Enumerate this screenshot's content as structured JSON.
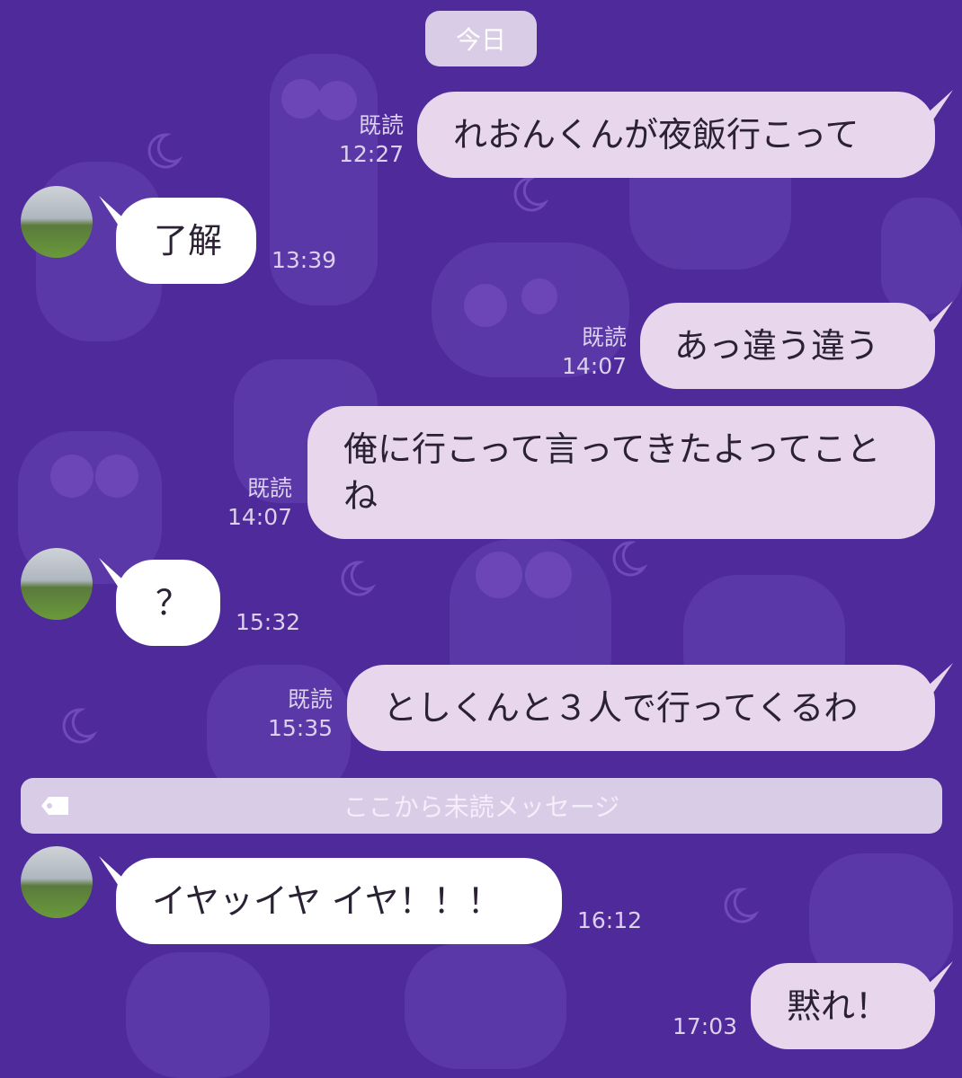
{
  "date_separator": "今日",
  "unread_divider": "ここから未読メッセージ",
  "colors": {
    "background": "#4e2a9a",
    "outgoing_bubble": "#e7d6ec",
    "incoming_bubble": "#ffffff",
    "pill": "#d9cce6"
  },
  "messages": [
    {
      "dir": "out",
      "text": "れおんくんが夜飯行こって",
      "read": "既読",
      "time": "12:27"
    },
    {
      "dir": "in",
      "text": "了解",
      "time": "13:39"
    },
    {
      "dir": "out",
      "text": "あっ違う違う",
      "read": "既読",
      "time": "14:07"
    },
    {
      "dir": "out",
      "text": "俺に行こって言ってきたよってことね",
      "read": "既読",
      "time": "14:07"
    },
    {
      "dir": "in",
      "text": "？",
      "time": "15:32"
    },
    {
      "dir": "out",
      "text": "としくんと３人で行ってくるわ",
      "read": "既読",
      "time": "15:35"
    },
    {
      "dir": "in",
      "text": "イヤッイヤ イヤ！！！",
      "time": "16:12"
    },
    {
      "dir": "out",
      "text": "黙れ！",
      "time": "17:03"
    }
  ],
  "icons": [
    "avatar",
    "tag-icon",
    "moon-icon"
  ]
}
